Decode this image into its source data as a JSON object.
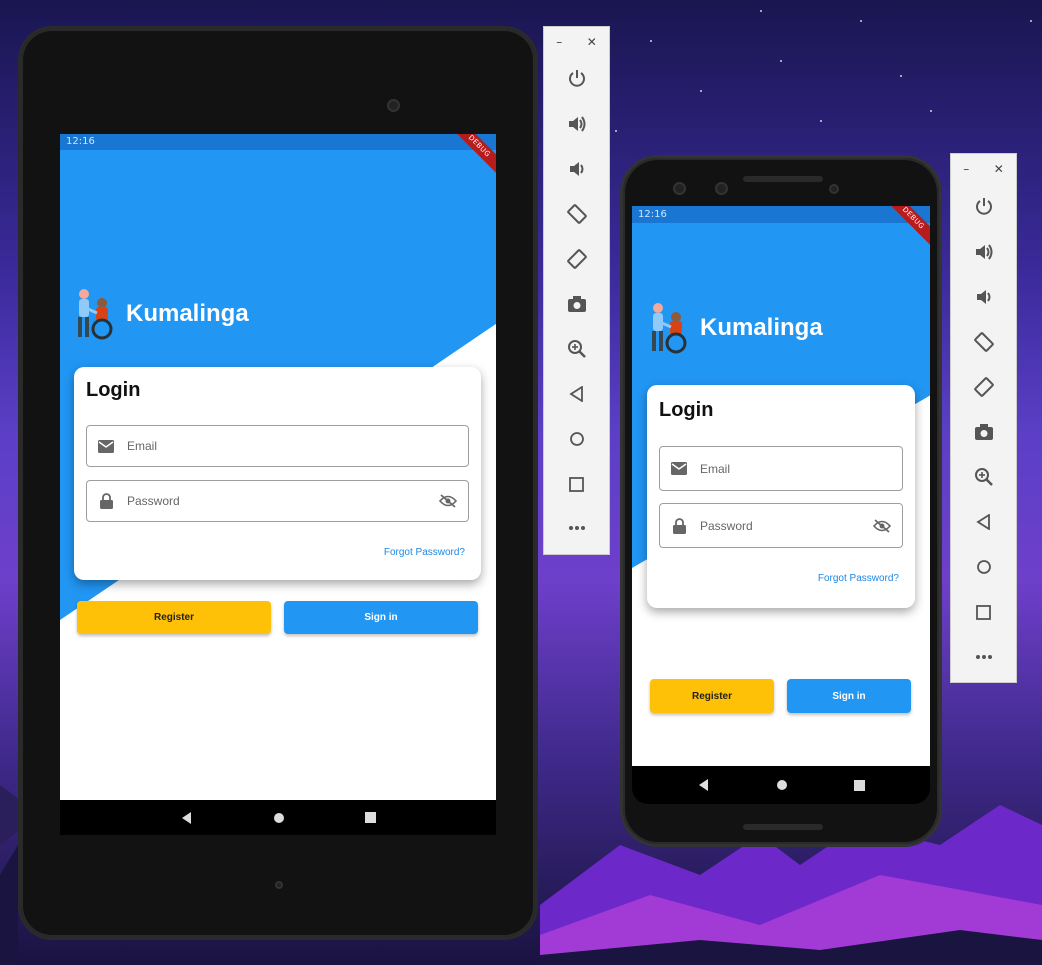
{
  "app": {
    "status_time": "12:16",
    "debug_label": "DEBUG",
    "brand_name": "Kumalinga",
    "login_title": "Login",
    "email_placeholder": "Email",
    "password_placeholder": "Password",
    "forgot_password": "Forgot Password?",
    "register_label": "Register",
    "signin_label": "Sign in"
  },
  "emulator_panel": {
    "minimize_label": "–",
    "close_label": "✕",
    "buttons": [
      "power-icon",
      "volume-up-icon",
      "volume-down-icon",
      "rotate-left-icon",
      "rotate-right-icon",
      "camera-icon",
      "zoom-icon",
      "back-icon",
      "home-icon",
      "overview-icon",
      "more-icon"
    ]
  },
  "colors": {
    "primary": "#2196f3",
    "status_bar": "#1976d2",
    "register": "#ffc107",
    "link": "#1e88e5"
  }
}
